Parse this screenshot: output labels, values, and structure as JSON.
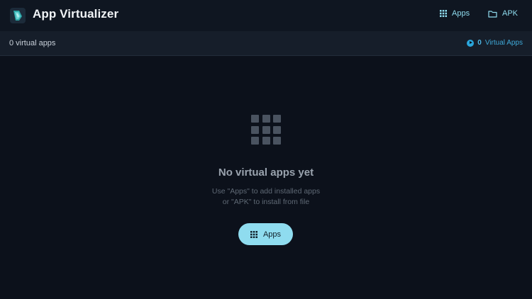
{
  "header": {
    "title": "App Virtualizer",
    "nav": {
      "apps_label": "Apps",
      "apk_label": "APK"
    }
  },
  "subbar": {
    "count_text": "0 virtual apps",
    "badge_count": "0",
    "badge_label": "Virtual Apps"
  },
  "empty_state": {
    "title": "No virtual apps yet",
    "hint_line1": "Use \"Apps\" to add installed apps",
    "hint_line2": "or \"APK\" to install from file",
    "button_label": "Apps"
  },
  "colors": {
    "accent": "#8fdcef",
    "background": "#0c111b",
    "badge": "#2aa6dc"
  },
  "icons": {
    "logo": "app-logo-icon",
    "apps": "grid-icon",
    "apk": "folder-icon",
    "empty": "grid-icon",
    "badge": "play-icon"
  }
}
